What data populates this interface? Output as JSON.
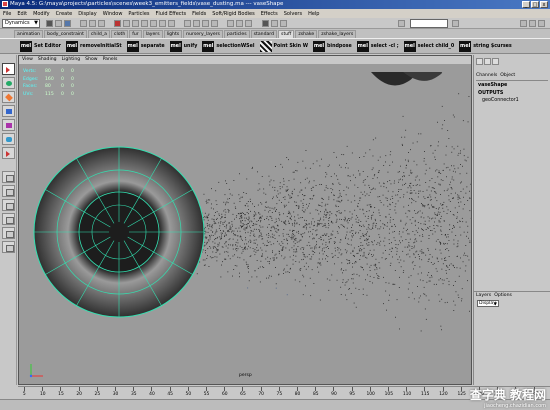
{
  "title_bar": {
    "title": "Maya 4.5: G:\\maya\\projects\\particles\\scenes\\week3_emitters_fields\\vase_dusting.ma  ---  vaseShape",
    "controls": [
      "_",
      "□",
      "x"
    ]
  },
  "menu_bar": {
    "items": [
      "File",
      "Edit",
      "Modify",
      "Create",
      "Display",
      "Window",
      "Particles",
      "Fluid Effects",
      "Fields",
      "Soft/Rigid Bodies",
      "Effects",
      "Solvers",
      "Help"
    ]
  },
  "status_line": {
    "mode": "Dynamics",
    "name_field": ""
  },
  "shelf_tabs": {
    "items": [
      "animation",
      "body_constraint",
      "child_a",
      "cloth",
      "fur",
      "layers",
      "lights",
      "nursery_layers",
      "particles",
      "standard",
      "stuff",
      "zshake",
      "zshake_layers"
    ],
    "active": "stuff"
  },
  "shelf": {
    "items": [
      {
        "icon": "mel",
        "label": "Set Editor"
      },
      {
        "icon": "mel",
        "label": "removeInitialSt"
      },
      {
        "icon": "mel",
        "label": "separate"
      },
      {
        "icon": "mel",
        "label": "unify"
      },
      {
        "icon": "mel",
        "label": "selectionWSel"
      },
      {
        "icon": "checker",
        "label": "Point Skin W"
      },
      {
        "icon": "mel",
        "label": "bindpose"
      },
      {
        "icon": "mel",
        "label": "select -cl ;"
      },
      {
        "icon": "mel",
        "label": "select child_0"
      },
      {
        "icon": "mel",
        "label": "string $curses"
      }
    ]
  },
  "viewport": {
    "panel_menu": [
      "View",
      "Shading",
      "Lighting",
      "Show",
      "Panels"
    ],
    "hud": [
      {
        "label": "Verts:",
        "values": [
          "80",
          "0",
          "0"
        ]
      },
      {
        "label": "Edges:",
        "values": [
          "160",
          "0",
          "0"
        ]
      },
      {
        "label": "Faces:",
        "values": [
          "80",
          "0",
          "0"
        ]
      },
      {
        "label": "UVs:",
        "values": [
          "115",
          "0",
          "0"
        ]
      }
    ],
    "camera_label": "persp"
  },
  "channel_box": {
    "menu": [
      "Channels",
      "Object"
    ],
    "node": "vaseShape",
    "outputs_header": "OUTPUTS",
    "outputs": [
      "geoConnector1"
    ]
  },
  "layers": {
    "menu": [
      "Layers",
      "Options"
    ],
    "dropdown": "Display"
  },
  "time_slider": {
    "ticks": [
      "5",
      "10",
      "15",
      "20",
      "25",
      "30",
      "35",
      "40",
      "45",
      "50",
      "55",
      "60",
      "65",
      "70",
      "75",
      "80",
      "85",
      "90",
      "95",
      "100",
      "105",
      "110",
      "115",
      "120",
      "125",
      "130",
      "135",
      "140",
      "145"
    ]
  },
  "watermark": {
    "title": "查字典 教程网",
    "url": "jiaocheng.chazidian.com"
  },
  "colors": {
    "wire": "#33e0b0",
    "viewport_bg": "#9b9b9b",
    "hud_label": "#55ffff"
  }
}
